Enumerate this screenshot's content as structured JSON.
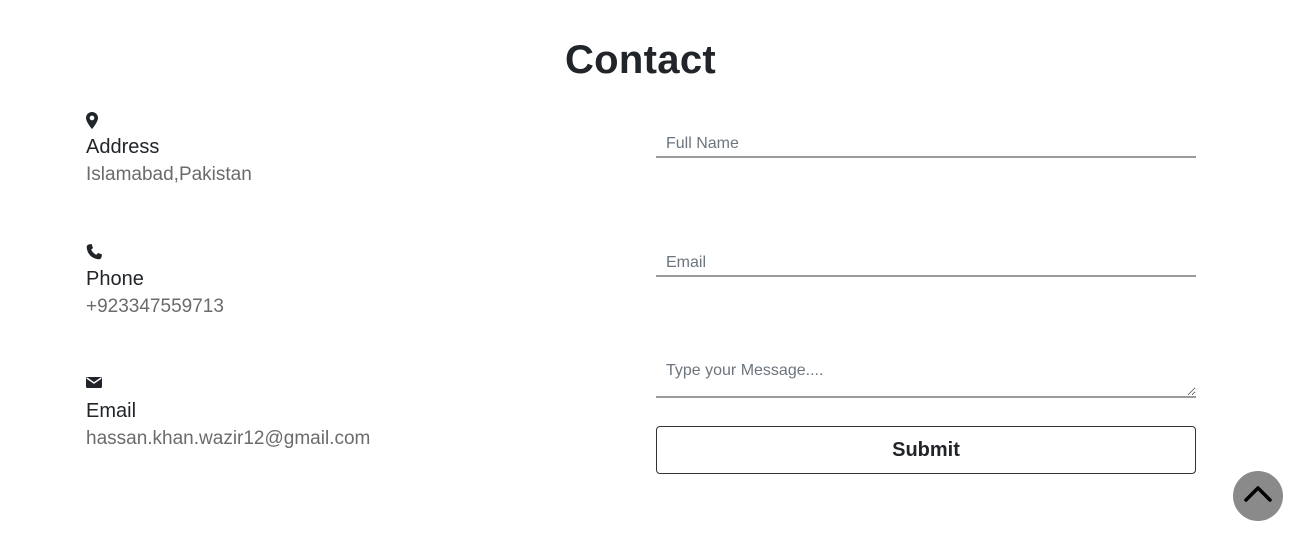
{
  "page": {
    "title": "Contact"
  },
  "contact_info": {
    "address": {
      "icon": "map-marker-icon",
      "label": "Address",
      "value": "Islamabad,Pakistan"
    },
    "phone": {
      "icon": "phone-icon",
      "label": "Phone",
      "value": "+923347559713"
    },
    "email": {
      "icon": "envelope-icon",
      "label": "Email",
      "value": "hassan.khan.wazir12@gmail.com"
    }
  },
  "form": {
    "full_name": {
      "placeholder": "Full Name",
      "value": ""
    },
    "email": {
      "placeholder": "Email",
      "value": ""
    },
    "message": {
      "placeholder": "Type your Message....",
      "value": ""
    },
    "submit_label": "Submit"
  },
  "scroll_top": {
    "icon": "chevron-up-icon"
  },
  "colors": {
    "text": "#212529",
    "muted": "#6b6b6b",
    "underline": "#9a9a9a",
    "scroll_button": "#8a8a8a"
  }
}
